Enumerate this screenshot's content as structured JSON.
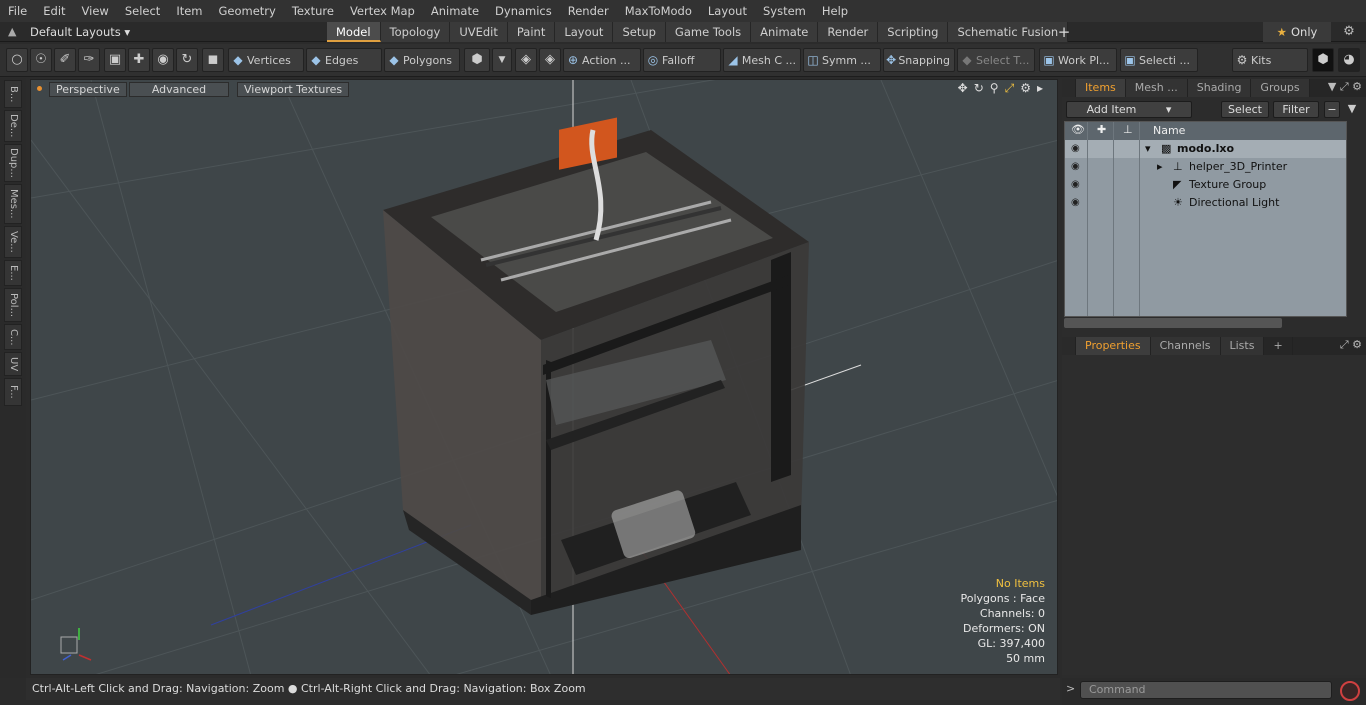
{
  "menubar": {
    "items": [
      "File",
      "Edit",
      "View",
      "Select",
      "Item",
      "Geometry",
      "Texture",
      "Vertex Map",
      "Animate",
      "Dynamics",
      "Render",
      "MaxToModo",
      "Layout",
      "System",
      "Help"
    ]
  },
  "tabbar": {
    "layout_selector": "Default Layouts ▾",
    "tabs": [
      "Model",
      "Topology",
      "UVEdit",
      "Paint",
      "Layout",
      "Setup",
      "Game Tools",
      "Animate",
      "Render",
      "Scripting",
      "Schematic Fusion"
    ],
    "active_tab": "Model",
    "add_tab": "+",
    "only_label": "Only"
  },
  "toolbar": {
    "vertices": "Vertices",
    "edges": "Edges",
    "polygons": "Polygons",
    "action": "Action ...",
    "falloff": "Falloff",
    "mesh": "Mesh C ...",
    "symmetry": "Symm ...",
    "snapping": "Snapping",
    "select_through": "Select T...",
    "work_plane": "Work Pl...",
    "selection": "Selecti ...",
    "kits": "Kits"
  },
  "left_tabs": [
    "B...",
    "De...",
    "Dup...",
    "Mes...",
    "Ve...",
    "E...",
    "Pol...",
    "C...",
    "UV",
    "F..."
  ],
  "viewport": {
    "view_mode": "Perspective",
    "shading": "Advanced",
    "textures": "Viewport Textures",
    "info": {
      "selection": "No Items",
      "polygons": "Polygons : Face",
      "channels": "Channels: 0",
      "deformers": "Deformers: ON",
      "gl": "GL: 397,400",
      "scale": "50 mm"
    }
  },
  "statusbar": {
    "hint": "Ctrl-Alt-Left Click and Drag: Navigation: Zoom ● Ctrl-Alt-Right Click and Drag: Navigation: Box Zoom"
  },
  "items_panel": {
    "tabs": [
      "Items",
      "Mesh ...",
      "Shading",
      "Groups"
    ],
    "active_tab": "Items",
    "add_item": "Add Item",
    "select": "Select",
    "filter": "Filter",
    "name_header": "Name",
    "tree": [
      {
        "label": "modo.lxo",
        "level": 0,
        "bold": true
      },
      {
        "label": "helper_3D_Printer",
        "level": 1
      },
      {
        "label": "Texture Group",
        "level": 1
      },
      {
        "label": "Directional Light",
        "level": 1
      }
    ]
  },
  "properties_panel": {
    "tabs": [
      "Properties",
      "Channels",
      "Lists"
    ],
    "active_tab": "Properties",
    "add": "+"
  },
  "command": {
    "prompt": ">",
    "placeholder": "Command"
  },
  "colors": {
    "accent": "#e8a030",
    "viewport_bg": "#3f4649",
    "tree_bg": "#909aa2"
  }
}
